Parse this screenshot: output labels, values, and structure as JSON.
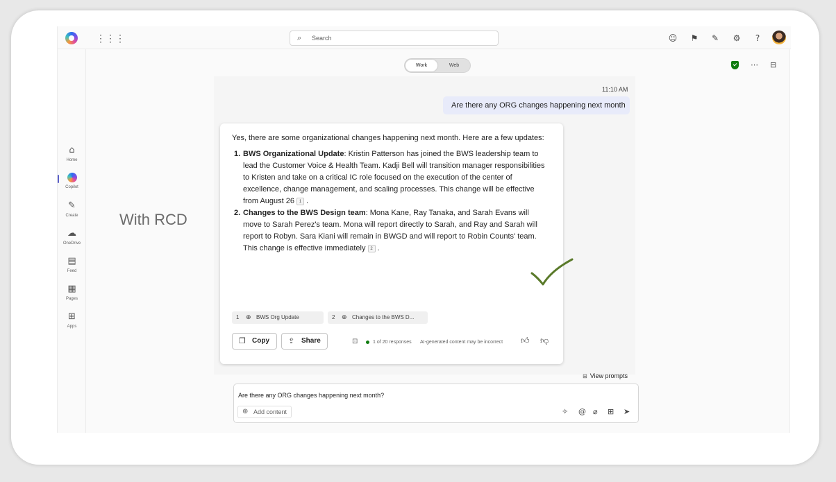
{
  "overlay_label": "With RCD",
  "topbar": {
    "search_placeholder": "Search"
  },
  "rail": {
    "items": [
      {
        "label": "Home",
        "icon": "home-icon"
      },
      {
        "label": "Copilot",
        "icon": "copilot-icon"
      },
      {
        "label": "Create",
        "icon": "pencil-icon"
      },
      {
        "label": "OneDrive",
        "icon": "cloud-icon"
      },
      {
        "label": "Feed",
        "icon": "feed-icon"
      },
      {
        "label": "Pages",
        "icon": "pages-icon"
      },
      {
        "label": "Apps",
        "icon": "apps-icon"
      }
    ]
  },
  "mode_toggle": {
    "work": "Work",
    "web": "Web",
    "selected": "Work"
  },
  "conversation": {
    "timestamp": "11:10 AM",
    "user_message": "Are there any ORG changes happening next month",
    "answer": {
      "intro": "Yes, there are some organizational changes happening next month. Here are a few updates:",
      "items": [
        {
          "number": "1.",
          "heading": "BWS Organizational Update",
          "text": ": Kristin Patterson has joined the BWS leadership team to lead the Customer Voice & Health Team. Kadji Bell will transition manager responsibilities to Kristen and take on a critical IC role focused on the execution of the center of excellence, change management, and scaling processes. This change will be effective from August 26",
          "citation": "1",
          "after": "."
        },
        {
          "number": "2.",
          "heading": "Changes to the BWS Design team",
          "text": ": Mona Kane, Ray Tanaka, and Sarah Evans will move to Sarah Perez's team. Mona will report directly to Sarah, and Ray and Sarah will report to Robyn. Sara Kiani will remain in BWGD and will report to Robin Counts' team. This change is effective immediately",
          "citation": "2",
          "after": "."
        }
      ],
      "references": [
        {
          "number": "1",
          "title": "BWS Org Update"
        },
        {
          "number": "2",
          "title": "Changes to the BWS D..."
        }
      ],
      "copy_label": "Copy",
      "share_label": "Share",
      "responses": "1 of 20 responses",
      "disclaimer": "AI-generated content may be incorrect"
    }
  },
  "view_prompts": "View prompts",
  "composer": {
    "value": "Are there any ORG changes happening next month?",
    "add_content": "Add content"
  },
  "colors": {
    "accent": "#5b5fc7",
    "user_bubble": "#e8ebfa",
    "checkmark": "#5a7a2a",
    "status_green": "#107c10"
  }
}
